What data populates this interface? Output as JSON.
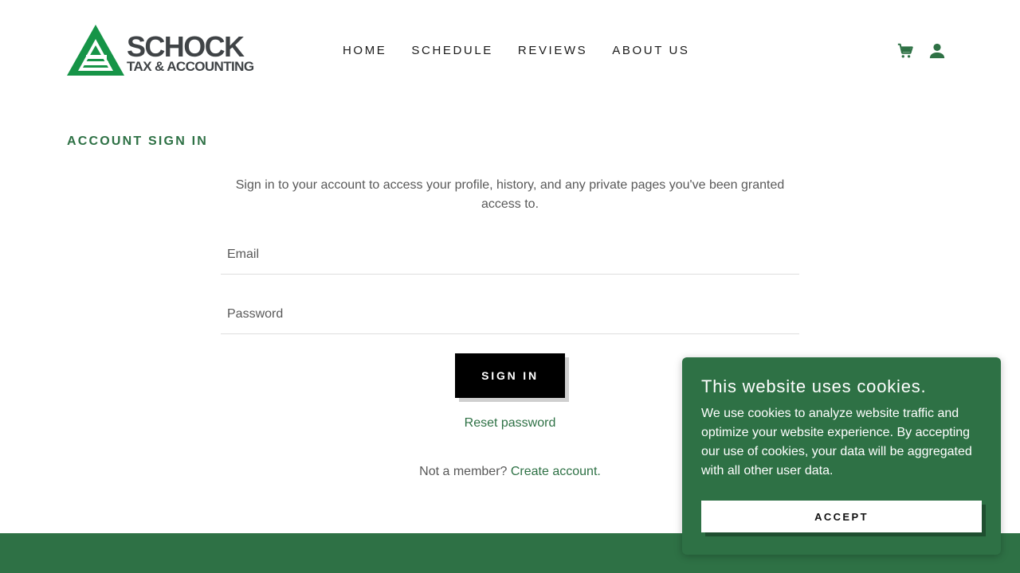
{
  "brand": {
    "name": "SCHOCK",
    "tagline": "TAX & ACCOUNTING",
    "color": "#2e7145",
    "logo_green": "#169447"
  },
  "nav": {
    "items": [
      {
        "label": "HOME"
      },
      {
        "label": "SCHEDULE"
      },
      {
        "label": "REVIEWS"
      },
      {
        "label": "ABOUT US"
      }
    ],
    "icons": [
      "cart-icon",
      "user-icon"
    ]
  },
  "signin": {
    "title": "ACCOUNT SIGN IN",
    "intro": "Sign in to your account to access your profile, history, and any private pages you've been granted access to.",
    "email_placeholder": "Email",
    "password_placeholder": "Password",
    "button_label": "SIGN IN",
    "reset_label": "Reset password",
    "member_prompt": "Not a member?",
    "create_label": "Create account."
  },
  "cookie": {
    "title": "This website uses cookies.",
    "text": "We use cookies to analyze website traffic and optimize your website experience. By accepting our use of cookies, your data will be aggregated with all other user data.",
    "accept_label": "ACCEPT",
    "background": "#2e7145"
  }
}
